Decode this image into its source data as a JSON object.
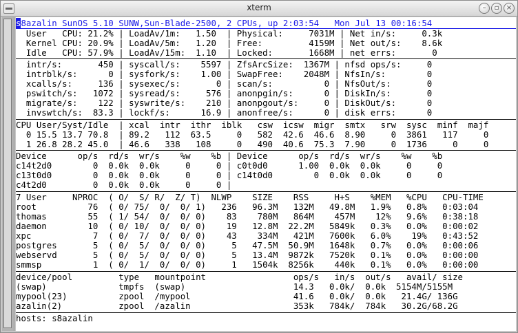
{
  "window": {
    "title": "xterm",
    "min_label": "–",
    "max_label": "▫",
    "close_label": "×"
  },
  "header": {
    "cursor_char": "s",
    "text": "8azalin SunOS 5.10 SUNW,Sun-Blade-2500, 2 CPUs, up 2:03:54   Mon Jul 13 00:16:54"
  },
  "summary_lines": [
    "  User   CPU: 21.2% | LoadAv/1m:   1.50  | Physical:     7031M | Net in/s:     0.3k",
    "  Kernel CPU: 20.9% | LoadAv/5m:   1.20  | Free:         4159M | Net out/s:    8.6k",
    "  Idle   CPU: 57.9% | LoadAv/15m:  1.10  | Locked:       1668M | net errs:       0"
  ],
  "rate_lines": [
    "  intr/s:       450 | syscall/s:    5597 | ZfsArcSize:  1367M | nfsd ops/s:     0",
    "  intrblk/s:      0 | sysfork/s:    1.00 | SwapFree:    2048M | NfsIn/s:        0",
    "  xcalls/s:     136 | sysexec/s:       0 | scan/s:          0 | NfsOut/s:       0",
    "  pswitch/s:   1072 | sysread/s:     576 | anonpgin/s:      0 | DiskIn/s:       0",
    "  migrate/s:    122 | syswrite/s:    210 | anonpgout/s:     0 | DiskOut/s:      0",
    "  invswtch/s:  83.3 | lockf/s:      16.9 | anonfree/s:      0 | disk errs:      0"
  ],
  "cpu_lines": [
    "CPU User/Syst/Idle  | xcal  intr  ithr  iblk   csw  icsw  migr  smtx   srw  sysc  minf  majf",
    "  0 15.5 13.7 70.8  | 89.2   112  63.5     0   582  42.6  46.6  8.90     0  3861   117     0",
    "  1 26.8 28.2 45.0  | 46.6   338   108     0   490  40.6  75.3  7.90     0  1736     0     0"
  ],
  "disk_lines": [
    "Device      op/s  rd/s  wr/s    %w    %b | Device      op/s  rd/s  wr/s    %w    %b",
    "c14t2d0        0  0.0k  0.0k     0     0 | c0t0d0      1.00  0.0k  0.0k     0     0",
    "c13t0d0        0  0.0k  0.0k     0     0 | c14t0d0        0  0.0k  0.0k     0     0",
    "c4t2d0         0  0.0k  0.0k     0     0 |"
  ],
  "process_lines": [
    "7 User     NPROC  ( O/  S/ R/  Z/ T)  NLWP    SIZE    RSS     H+S    %MEM   %CPU   CPU-TIME",
    "root          76  ( 0/ 75/  0/  0/ 1)   236   96.3M   132M   49.8M   1.9%   0.8%   0:03:04",
    "thomas        55  ( 1/ 54/  0/  0/ 0)    83    780M   864M    457M    12%   9.6%   0:38:18",
    "daemon        10  ( 0/ 10/  0/  0/ 0)    19   12.8M  22.2M   5849k   0.3%   0.0%   0:00:02",
    "xpc            7  ( 0/  7/  0/  0/ 0)    43    334M   421M   7600k   6.0%    19%   0:43:52",
    "postgres       5  ( 0/  5/  0/  0/ 0)     5   47.5M  50.9M   1648k   0.7%   0.0%   0:00:06",
    "webservd       5  ( 0/  5/  0/  0/ 0)     5   13.4M  9872k   7520k   0.1%   0.0%   0:00:00",
    "smmsp          1  ( 0/  1/  0/  0/ 0)     1   1504k  8256k    440k   0.1%   0.0%   0:00:00"
  ],
  "fs_lines": [
    "device/pool         type   mountpoint                 ops/s   in/s  out/s   avail/ size",
    "(swap)              tmpfs  (swap)                     14.3   0.0k/  0.0k  5154M/5155M",
    "mypool(23)          zpool  /mypool                    41.6   0.0k/  0.0k   21.4G/ 136G",
    "azalin(2)           zpool  /azalin                    353k   784k/  784k   30.2G/68.2G"
  ],
  "footer": "hosts: s8azalin"
}
